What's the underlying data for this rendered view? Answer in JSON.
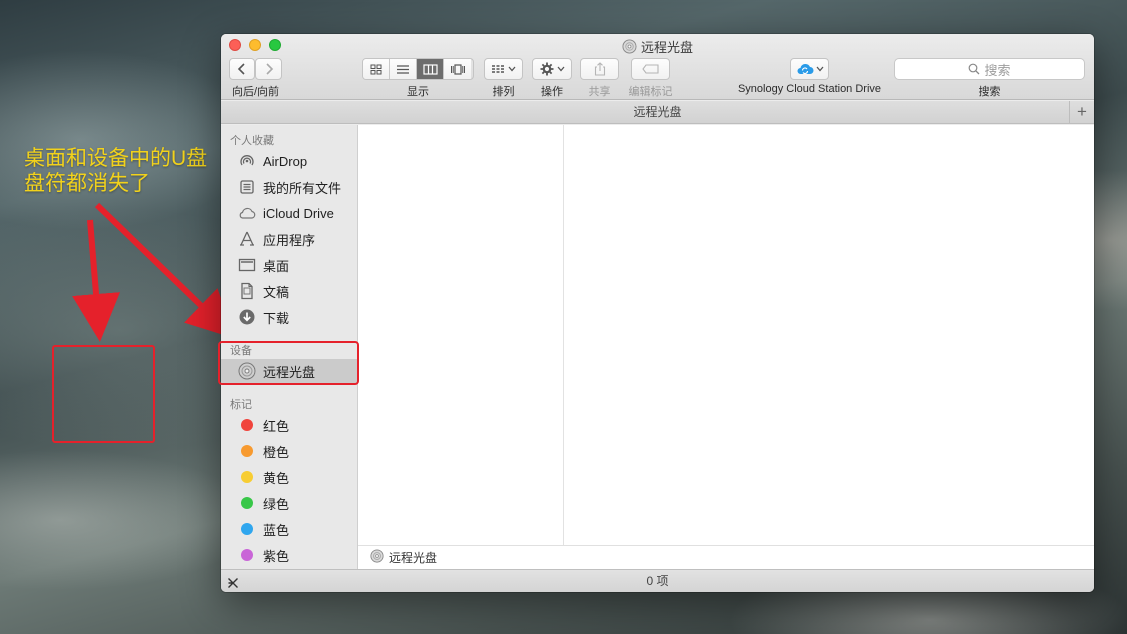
{
  "annotation": {
    "text": "桌面和设备中的U盘盘符都消失了",
    "color": "#f2d21b",
    "arrow_color": "#e5212b"
  },
  "window": {
    "title": "远程光盘",
    "toolbar": {
      "back_forward_label": "向后/向前",
      "view_label": "显示",
      "arrange_label": "排列",
      "action_label": "操作",
      "share_label": "共享",
      "tags_label": "编辑标记",
      "cloud_label": "Synology Cloud Station Drive",
      "search_placeholder": "搜索",
      "search_label": "搜索",
      "active_view": "column"
    },
    "path_title": "远程光盘",
    "sidebar": {
      "favorites_header": "个人收藏",
      "favorites": [
        {
          "label": "AirDrop",
          "icon": "airdrop-icon"
        },
        {
          "label": "我的所有文件",
          "icon": "all-files-icon"
        },
        {
          "label": "iCloud Drive",
          "icon": "cloud-icon"
        },
        {
          "label": "应用程序",
          "icon": "applications-icon"
        },
        {
          "label": "桌面",
          "icon": "desktop-icon"
        },
        {
          "label": "文稿",
          "icon": "document-icon"
        },
        {
          "label": "下载",
          "icon": "download-icon"
        }
      ],
      "devices_header": "设备",
      "devices": [
        {
          "label": "远程光盘",
          "icon": "optical-disc-icon",
          "selected": true
        }
      ],
      "tags_header": "标记",
      "tags": [
        {
          "label": "红色",
          "color": "#f0443c"
        },
        {
          "label": "橙色",
          "color": "#f79a2f"
        },
        {
          "label": "黄色",
          "color": "#f7cd33"
        },
        {
          "label": "绿色",
          "color": "#38c748"
        },
        {
          "label": "蓝色",
          "color": "#2fa6ee"
        },
        {
          "label": "紫色",
          "color": "#c965d7"
        }
      ]
    },
    "pathbar_bottom": "远程光盘",
    "status": "0 项"
  }
}
